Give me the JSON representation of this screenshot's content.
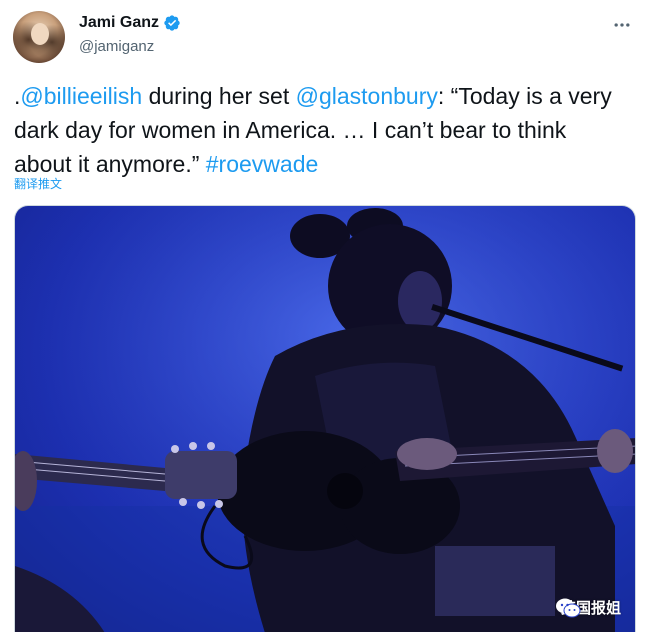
{
  "author": {
    "display_name": "Jami Ganz",
    "handle": "@jamiganz",
    "verified": true
  },
  "tweet": {
    "text_prefix": ".",
    "mention_1": "@billieeilish",
    "text_mid_1": " during her set ",
    "mention_2": "@glastonbury",
    "text_mid_2": ": “Today is a very dark day for women in America. … I can’t bear to think about it anymore.” ",
    "hashtag": "#roevwade"
  },
  "translate_label": "翻译推文",
  "media": {
    "watermark_text": "英国报姐"
  },
  "colors": {
    "link": "#1d9bf0",
    "text": "#0f1419",
    "secondary": "#536471",
    "stage_blue": "#2a42c8"
  },
  "icons": {
    "verified": "verified-badge-icon",
    "more": "more-options-icon",
    "watermark": "wechat-icon"
  }
}
